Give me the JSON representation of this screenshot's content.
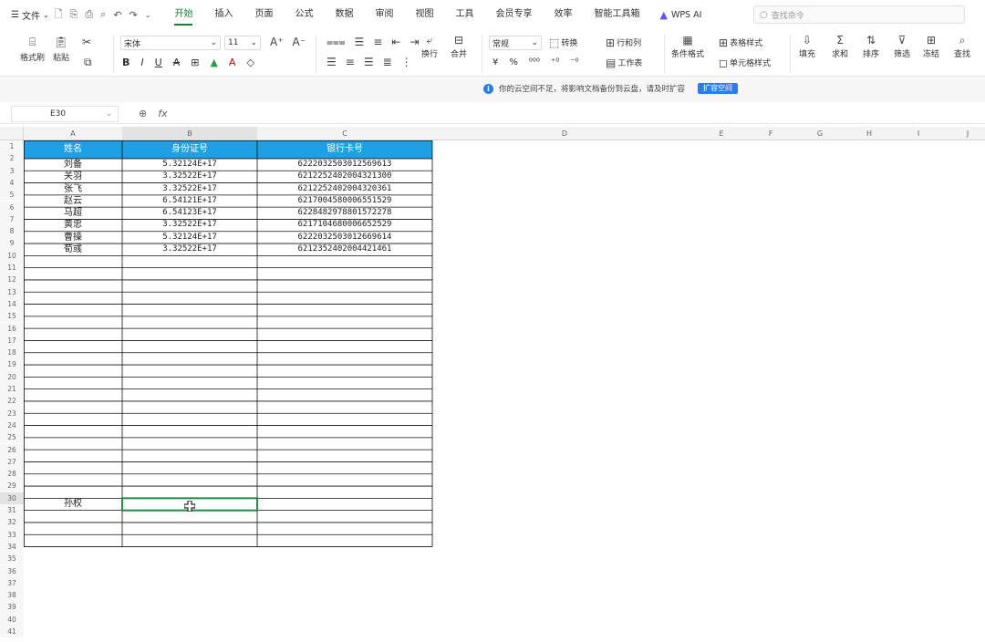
{
  "topbar": {
    "menu_label": "文件",
    "tabs": [
      "开始",
      "插入",
      "页面",
      "公式",
      "数据",
      "审阅",
      "视图",
      "工具",
      "会员专享",
      "效率",
      "智能工具箱"
    ],
    "active_tab": "开始",
    "wps_ai": "WPS AI",
    "search_placeholder": "查找命令"
  },
  "ribbon": {
    "format_painter": "格式刷",
    "paste": "粘贴",
    "font_name": "宋体",
    "font_size": "11",
    "wrap": "换行",
    "merge": "合并",
    "number_format": "常规",
    "convert": "转换",
    "row_col": "行和列",
    "worksheet": "工作表",
    "table_style": "表格样式",
    "cond_format": "条件格式",
    "cell_style": "单元格样式",
    "fill": "填充",
    "sum": "求和",
    "sort": "排序",
    "filter": "筛选",
    "freeze": "冻结",
    "find": "查找"
  },
  "notice": {
    "text": "你的云空间不足，将影响文档备份到云盘，请及时扩容",
    "button": "扩容空间"
  },
  "formula_bar": {
    "cell_ref": "E30",
    "value": ""
  },
  "sheet": {
    "columns": [
      "A",
      "B",
      "C",
      "D",
      "E",
      "F",
      "G",
      "H",
      "I",
      "J"
    ],
    "headers": [
      "姓名",
      "身份证号",
      "银行卡号"
    ],
    "rows": [
      [
        "刘备",
        "5.32124E+17",
        "6222032503012569613"
      ],
      [
        "关羽",
        "3.32522E+17",
        "6212252402004321300"
      ],
      [
        "张飞",
        "3.32522E+17",
        "6212252402004320361"
      ],
      [
        "赵云",
        "6.54121E+17",
        "6217004580006551529"
      ],
      [
        "马超",
        "6.54123E+17",
        "6228482978801572278"
      ],
      [
        "黄忠",
        "3.32522E+17",
        "6217104680006652529"
      ],
      [
        "曹操",
        "5.32124E+17",
        "6222032503012669614"
      ],
      [
        "荀彧",
        "3.32522E+17",
        "6212352402004421461"
      ]
    ],
    "row30_a": "孙权",
    "row_count": 41
  },
  "colors": {
    "header_fill": "#1ea0e6",
    "accent_green": "#1a7f37",
    "selection": "#1d8f4b"
  }
}
